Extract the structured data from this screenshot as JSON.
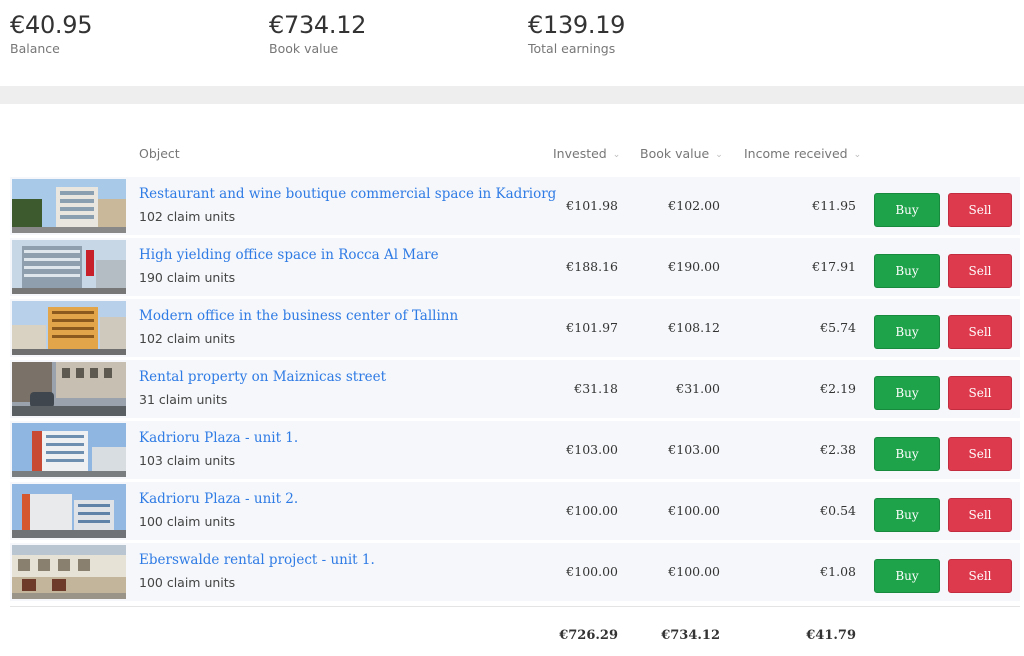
{
  "summary": {
    "balance": {
      "value": "€40.95",
      "label": "Balance"
    },
    "book_value": {
      "value": "€734.12",
      "label": "Book value"
    },
    "total_earnings": {
      "value": "€139.19",
      "label": "Total earnings"
    }
  },
  "table": {
    "headers": {
      "object": "Object",
      "invested": "Invested",
      "book_value": "Book value",
      "income_received": "Income received"
    },
    "buy_label": "Buy",
    "sell_label": "Sell",
    "rows": [
      {
        "title": "Restaurant and wine boutique commercial space in Kadriorg",
        "units": "102 claim units",
        "invested": "€101.98",
        "book_value": "€102.00",
        "income": "€11.95"
      },
      {
        "title": "High yielding office space in Rocca Al Mare",
        "units": "190 claim units",
        "invested": "€188.16",
        "book_value": "€190.00",
        "income": "€17.91"
      },
      {
        "title": "Modern office in the business center of Tallinn",
        "units": "102 claim units",
        "invested": "€101.97",
        "book_value": "€108.12",
        "income": "€5.74"
      },
      {
        "title": "Rental property on Maiznicas street",
        "units": "31 claim units",
        "invested": "€31.18",
        "book_value": "€31.00",
        "income": "€2.19"
      },
      {
        "title": "Kadrioru Plaza - unit 1.",
        "units": "103 claim units",
        "invested": "€103.00",
        "book_value": "€103.00",
        "income": "€2.38"
      },
      {
        "title": "Kadrioru Plaza - unit 2.",
        "units": "100 claim units",
        "invested": "€100.00",
        "book_value": "€100.00",
        "income": "€0.54"
      },
      {
        "title": "Eberswalde rental project - unit 1.",
        "units": "100 claim units",
        "invested": "€100.00",
        "book_value": "€100.00",
        "income": "€1.08"
      }
    ],
    "totals": {
      "invested": "€726.29",
      "book_value": "€734.12",
      "income": "€41.79"
    }
  },
  "colors": {
    "link": "#2f7be5",
    "buy": "#1fa34a",
    "sell": "#de3a4d",
    "row_bg": "#f5f7fa"
  }
}
